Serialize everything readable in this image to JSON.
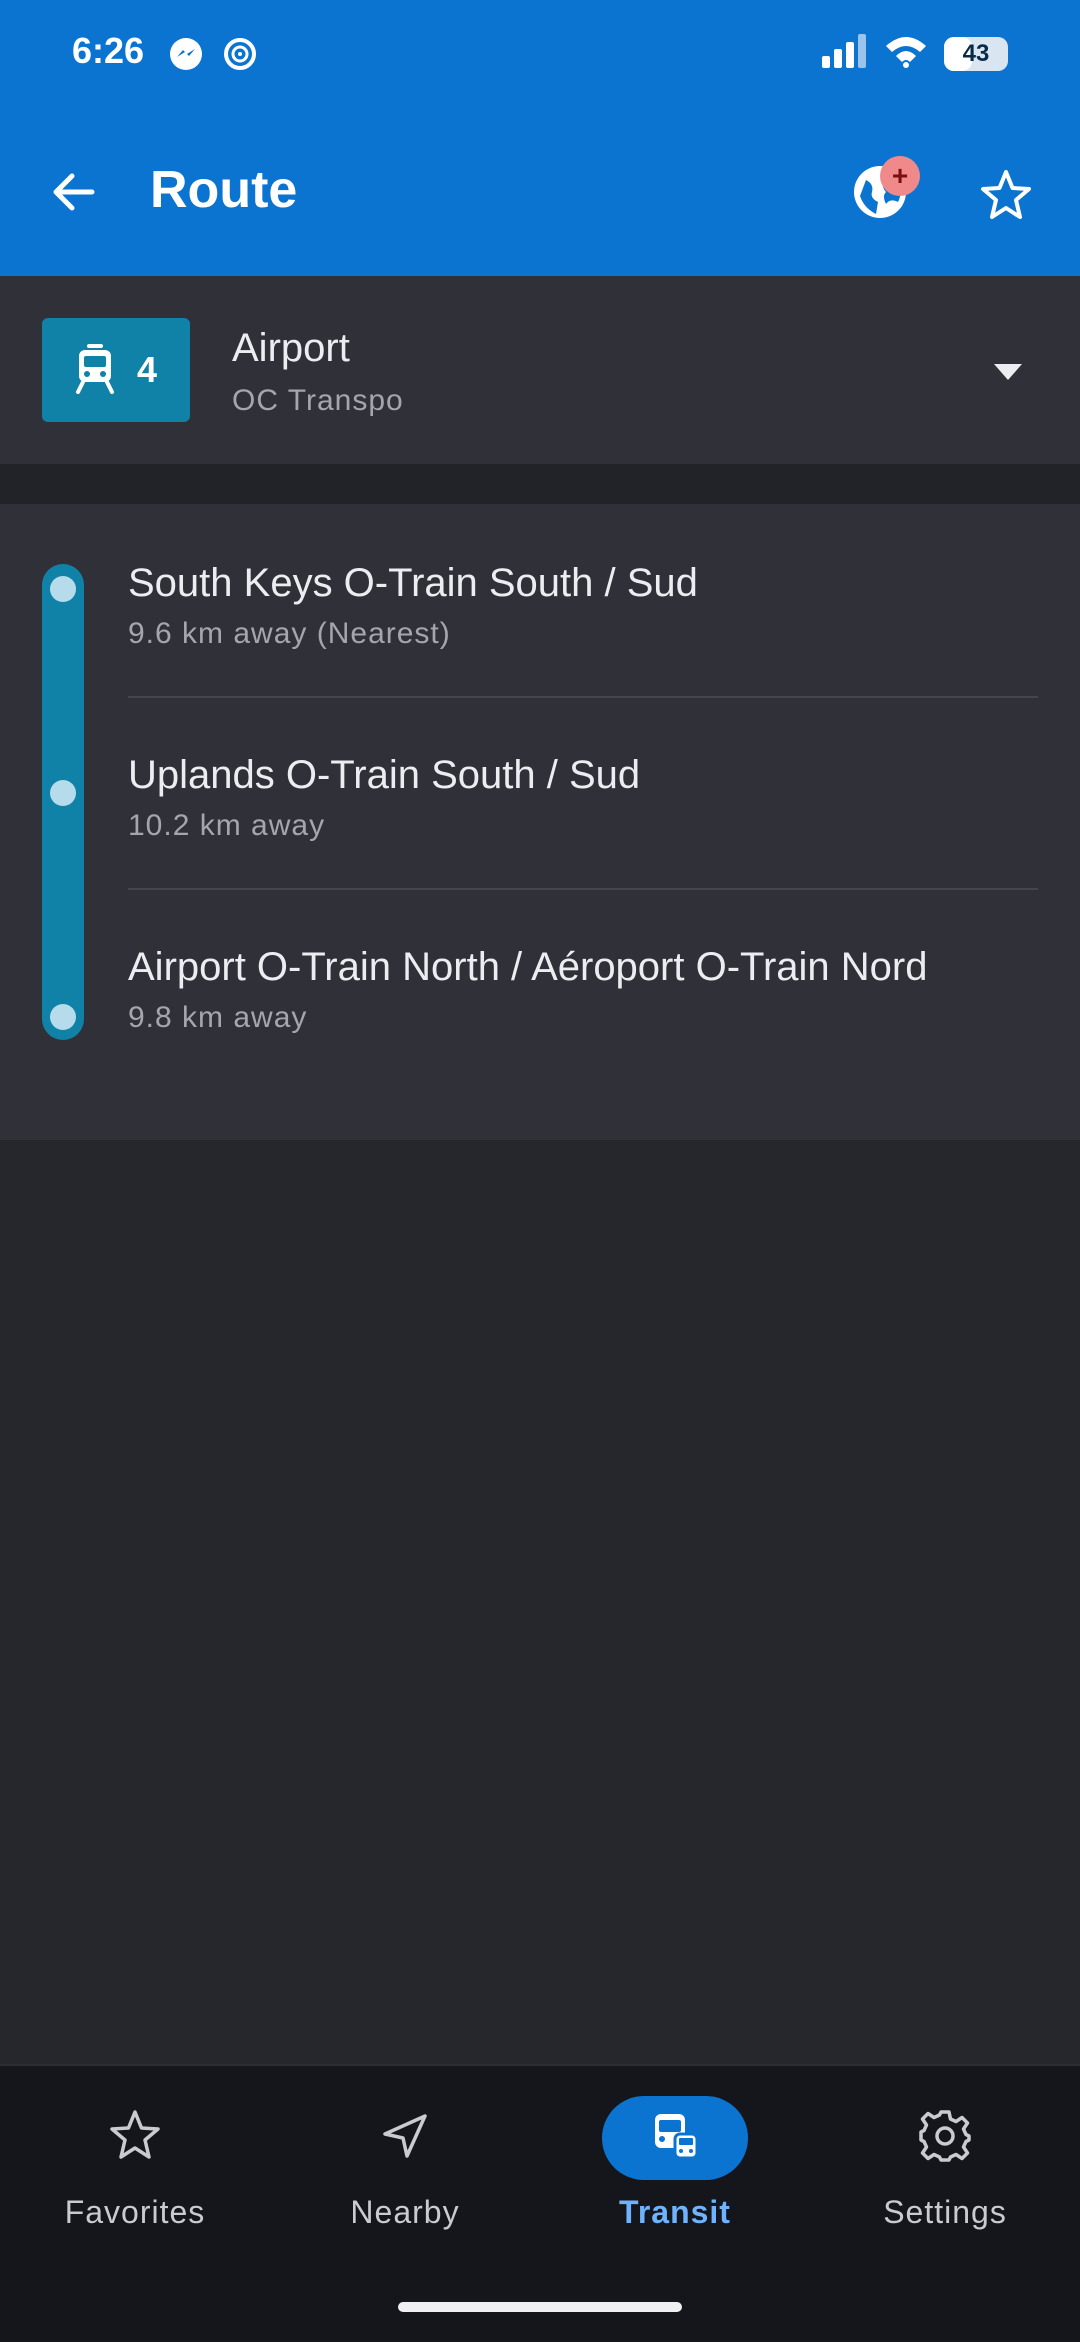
{
  "status_bar": {
    "time": "6:26",
    "battery": "43",
    "battery_level": 0.43
  },
  "app_bar": {
    "title": "Route",
    "badge": "+"
  },
  "route": {
    "number": "4",
    "name": "Airport",
    "agency": "OC Transpo",
    "color": "#1182a7"
  },
  "stops": [
    {
      "name": "South Keys O-Train South / Sud",
      "distance": "9.6 km away (Nearest)"
    },
    {
      "name": "Uplands O-Train South / Sud",
      "distance": "10.2 km away"
    },
    {
      "name": "Airport O-Train North / Aéroport O-Train Nord",
      "distance": "9.8 km away"
    }
  ],
  "nav": {
    "favorites": "Favorites",
    "nearby": "Nearby",
    "transit": "Transit",
    "settings": "Settings",
    "active": "transit"
  },
  "icons": [
    "messenger-icon",
    "threads-icon",
    "signal-icon",
    "wifi-icon",
    "back-arrow-icon",
    "globe-icon",
    "star-icon",
    "tram-icon",
    "dropdown-icon",
    "navigation-arrow-icon",
    "train-icon",
    "gear-icon"
  ],
  "colors": {
    "primary": "#0a74d0",
    "background": "#26272d",
    "surface": "#303138",
    "active_nav_label": "#6fb3ff"
  }
}
